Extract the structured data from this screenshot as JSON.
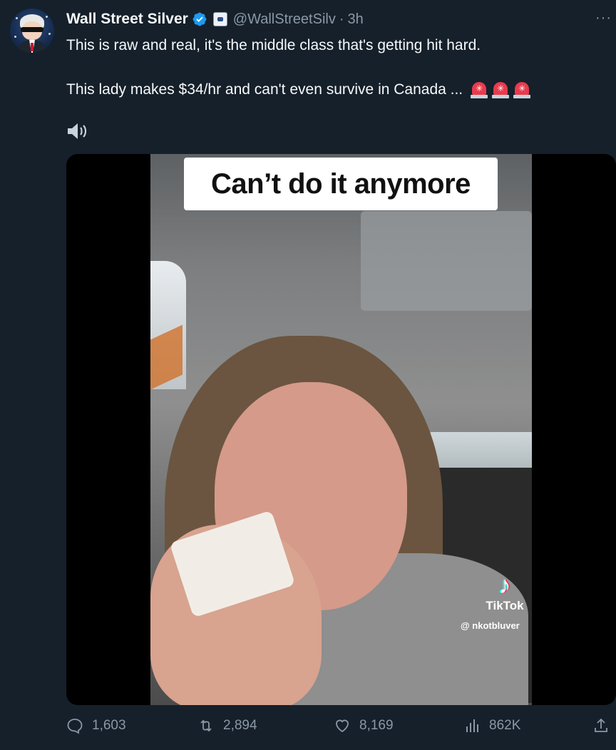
{
  "author": {
    "name": "Wall Street Silver",
    "handle": "@WallStreetSilv",
    "separator": "·",
    "time": "3h"
  },
  "menu": {
    "more_label": "···"
  },
  "tweet": {
    "line1": "This is raw and real, it's the middle class that's getting hit hard.",
    "line2": "This lady makes $34/hr and can't even survive in Canada ...",
    "emojis": [
      "rotating-light-icon",
      "rotating-light-icon",
      "rotating-light-icon"
    ]
  },
  "media": {
    "caption": "Can’t do it anymore",
    "watermark_brand": "TikTok",
    "watermark_user": "@ nkotbluver",
    "sound_icon": "speaker-icon"
  },
  "stats": {
    "replies": "1,603",
    "retweets": "2,894",
    "likes": "8,169",
    "views": "862K"
  },
  "colors": {
    "background": "#15202b",
    "text": "#f7f9f9",
    "muted": "#8b98a5",
    "verified": "#1d9bf0"
  }
}
